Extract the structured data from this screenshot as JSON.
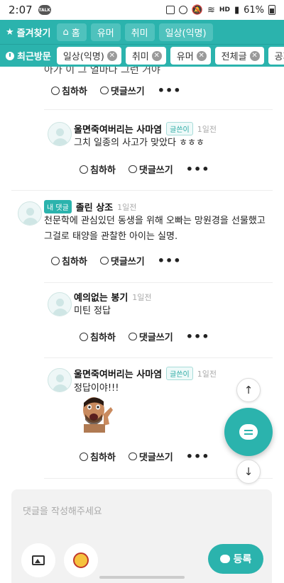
{
  "status_bar": {
    "time": "2:07",
    "talk_badge": "TALK",
    "hd": "HD",
    "battery": "61%"
  },
  "favorites_bar": {
    "label": "즐겨찾기",
    "chips": [
      "홈",
      "유머",
      "취미",
      "일상(익명)"
    ]
  },
  "recent_bar": {
    "label": "최근방문",
    "chips": [
      "일상(익명)",
      "취미",
      "유머",
      "전체글",
      "공지"
    ]
  },
  "actions": {
    "like": "침하하",
    "reply": "댓글쓰기",
    "more": "•••"
  },
  "partial_comment_text": "아가 이 그 얼마나 그런 거야",
  "comments": [
    {
      "author": "울면죽여버리는 사마염",
      "badge": "글쓴이",
      "time": "1일전",
      "text": "그치 일종의 사고가 맞았다 ㅎㅎㅎ"
    },
    {
      "author": "졸린 상조",
      "badge": "내 댓글",
      "time": "1일전",
      "text_line1": "천문학에 관심있던 동생을 위해 오빠는 망원경을 선물했고",
      "text_line2": "그걸로 태양을 관찰한 아이는 실명."
    },
    {
      "author": "예의없는 봉기",
      "badge": "",
      "time": "1일전",
      "text": "미틴 정답"
    },
    {
      "author": "울면죽여버리는 사마염",
      "badge": "글쓴이",
      "time": "1일전",
      "text": "정답이야!!!"
    }
  ],
  "composer": {
    "placeholder": "댓글을 작성해주세요",
    "submit_label": "등록"
  },
  "colors": {
    "accent": "#2bb3ad"
  }
}
